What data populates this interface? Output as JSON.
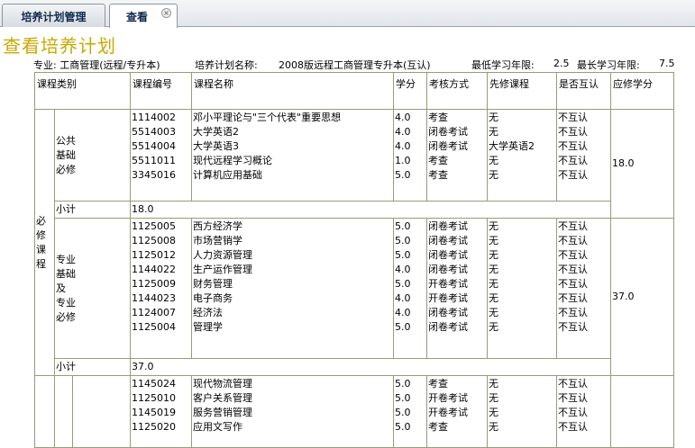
{
  "tabs": [
    {
      "label": "培养计划管理"
    },
    {
      "label": "查看"
    }
  ],
  "page_title": "查看培养计划",
  "info": {
    "major": "专业: 工商管理(远程/专升本)",
    "plan_label": "培养计划名称:",
    "plan_name": "2008版远程工商管理专升本(互认)",
    "min_years": "最低学习年限:",
    "min_val": "2.5",
    "max_years": "最长学习年限:",
    "max_val": "7.5"
  },
  "columns": [
    "课程类别",
    "课程编号",
    "课程名称",
    "学分",
    "考核方式",
    "先修课程",
    "是否互认",
    "应修学分"
  ],
  "group_label": "必修课程",
  "sections": [
    {
      "label": "公共基础必修",
      "codes": [
        "1114002",
        "5514003",
        "5514004",
        "5511011",
        "3345016"
      ],
      "names": [
        "邓小平理论与\"三个代表\"重要思想",
        "大学英语2",
        "大学英语3",
        "现代远程学习概论",
        "计算机应用基础"
      ],
      "credits": [
        "4.0",
        "4.0",
        "4.0",
        "1.0",
        "5.0"
      ],
      "exams": [
        "考查",
        "闭卷考试",
        "闭卷考试",
        "考查",
        "考查"
      ],
      "prereqs": [
        "无",
        "无",
        "大学英语2",
        "无",
        "无"
      ],
      "mutual": [
        "不互认",
        "不互认",
        "不互认",
        "不互认",
        "不互认"
      ],
      "required": "18.0",
      "subtotal_label": "小计",
      "subtotal": "18.0"
    },
    {
      "label": "专业基础及专业必修",
      "codes": [
        "1125005",
        "1125008",
        "1125012",
        "1144022",
        "1125009",
        "1144023",
        "1124007",
        "1125004"
      ],
      "names": [
        "西方经济学",
        "市场营销学",
        "人力资源管理",
        "生产运作管理",
        "财务管理",
        "电子商务",
        "经济法",
        "管理学"
      ],
      "credits": [
        "5.0",
        "5.0",
        "5.0",
        "4.0",
        "5.0",
        "4.0",
        "4.0",
        "5.0"
      ],
      "exams": [
        "闭卷考试",
        "闭卷考试",
        "闭卷考试",
        "闭卷考试",
        "开卷考试",
        "开卷考试",
        "闭卷考试",
        "闭卷考试"
      ],
      "prereqs": [
        "无",
        "无",
        "无",
        "无",
        "无",
        "无",
        "无",
        "无"
      ],
      "mutual": [
        "不互认",
        "不互认",
        "不互认",
        "不互认",
        "不互认",
        "不互认",
        "不互认",
        "不互认"
      ],
      "required": "37.0",
      "subtotal_label": "小计",
      "subtotal": "37.0"
    },
    {
      "label": "",
      "codes": [
        "1145024",
        "1125010",
        "1145019",
        "1125020"
      ],
      "names": [
        "现代物流管理",
        "客户关系管理",
        "服务营销管理",
        "应用文写作"
      ],
      "credits": [
        "5.0",
        "5.0",
        "5.0",
        "5.0"
      ],
      "exams": [
        "考查",
        "开卷考试",
        "开卷考试",
        "考查"
      ],
      "prereqs": [
        "无",
        "无",
        "无",
        "无"
      ],
      "mutual": [
        "不互认",
        "不互认",
        "不互认",
        "不互认"
      ],
      "required": ""
    }
  ]
}
